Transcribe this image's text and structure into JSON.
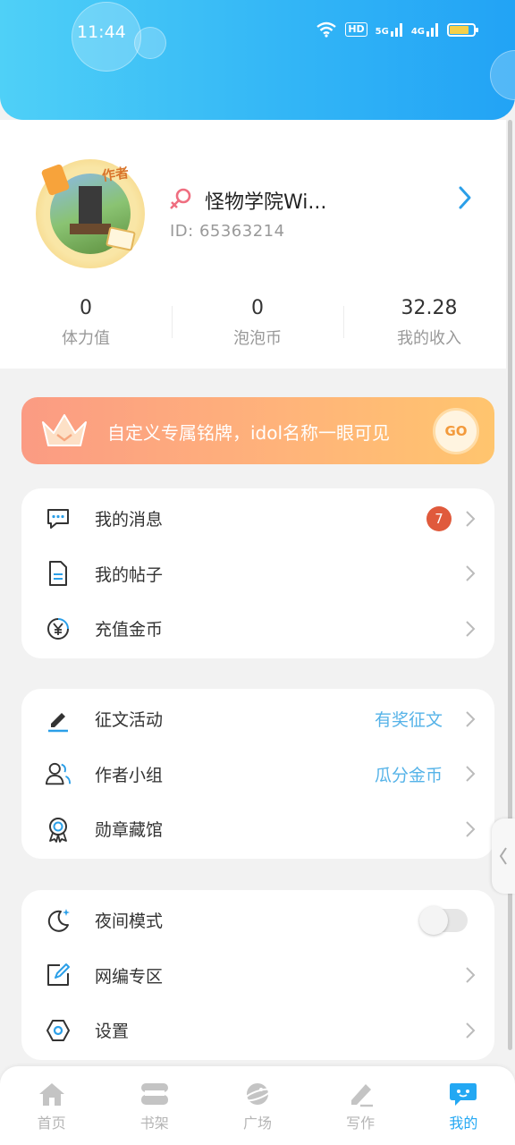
{
  "status_bar": {
    "time": "11:44",
    "hd": "HD",
    "net1": "5G",
    "net2": "4G",
    "battery_level": 0.8
  },
  "profile": {
    "author_tag": "作者",
    "username": "怪物学院Wi...",
    "user_id": "ID:  65363214"
  },
  "stats": [
    {
      "value": "0",
      "label": "体力值"
    },
    {
      "value": "0",
      "label": "泡泡币"
    },
    {
      "value": "32.28",
      "label": "我的收入"
    }
  ],
  "promo": {
    "text": "自定义专属铭牌，idol名称一眼可见",
    "button": "GO"
  },
  "menu_group_1": [
    {
      "label": "我的消息",
      "icon": "message-icon",
      "badge": "7"
    },
    {
      "label": "我的帖子",
      "icon": "document-icon"
    },
    {
      "label": "充值金币",
      "icon": "yen-coin-icon"
    }
  ],
  "menu_group_2": [
    {
      "label": "征文活动",
      "icon": "pen-icon",
      "extra": "有奖征文"
    },
    {
      "label": "作者小组",
      "icon": "group-icon",
      "extra": "瓜分金币"
    },
    {
      "label": "勋章藏馆",
      "icon": "medal-icon"
    }
  ],
  "menu_group_3": [
    {
      "label": "夜间模式",
      "icon": "moon-icon",
      "toggle_on": false
    },
    {
      "label": "网编专区",
      "icon": "edit-box-icon"
    },
    {
      "label": "设置",
      "icon": "settings-icon"
    }
  ],
  "tabs": [
    {
      "label": "首页",
      "icon": "home-icon"
    },
    {
      "label": "书架",
      "icon": "bookshelf-icon"
    },
    {
      "label": "广场",
      "icon": "planet-icon"
    },
    {
      "label": "写作",
      "icon": "write-icon"
    },
    {
      "label": "我的",
      "icon": "chat-bubble-icon",
      "active": true
    }
  ],
  "colors": {
    "accent": "#23a8f3",
    "badge": "#e05a3c",
    "promo_start": "#fb9b83",
    "promo_end": "#ffc56e",
    "extra_text": "#56b3e8"
  }
}
